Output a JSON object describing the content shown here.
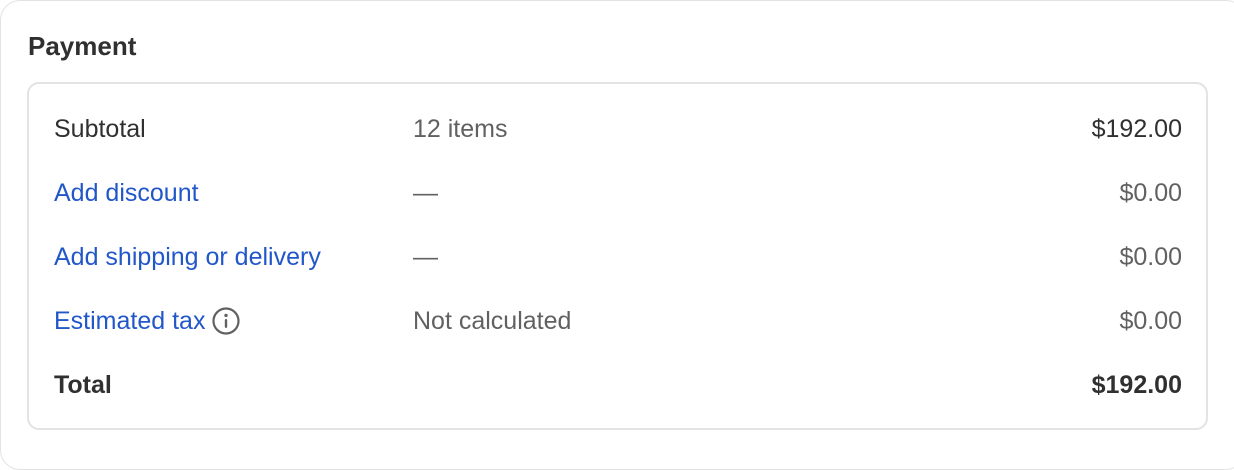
{
  "payment": {
    "title": "Payment",
    "rows": [
      {
        "label": "Subtotal",
        "detail": "12 items",
        "amount": "$192.00"
      },
      {
        "label": "Add discount",
        "detail": "—",
        "amount": "$0.00"
      },
      {
        "label": "Add shipping or delivery",
        "detail": "—",
        "amount": "$0.00"
      },
      {
        "label": "Estimated tax",
        "detail": "Not calculated",
        "amount": "$0.00",
        "icon": "info-icon"
      },
      {
        "label": "Total",
        "detail": "",
        "amount": "$192.00"
      }
    ]
  },
  "colors": {
    "link": "#2157c9",
    "text": "#303030",
    "muted": "#616161",
    "border": "#e3e3e3"
  }
}
